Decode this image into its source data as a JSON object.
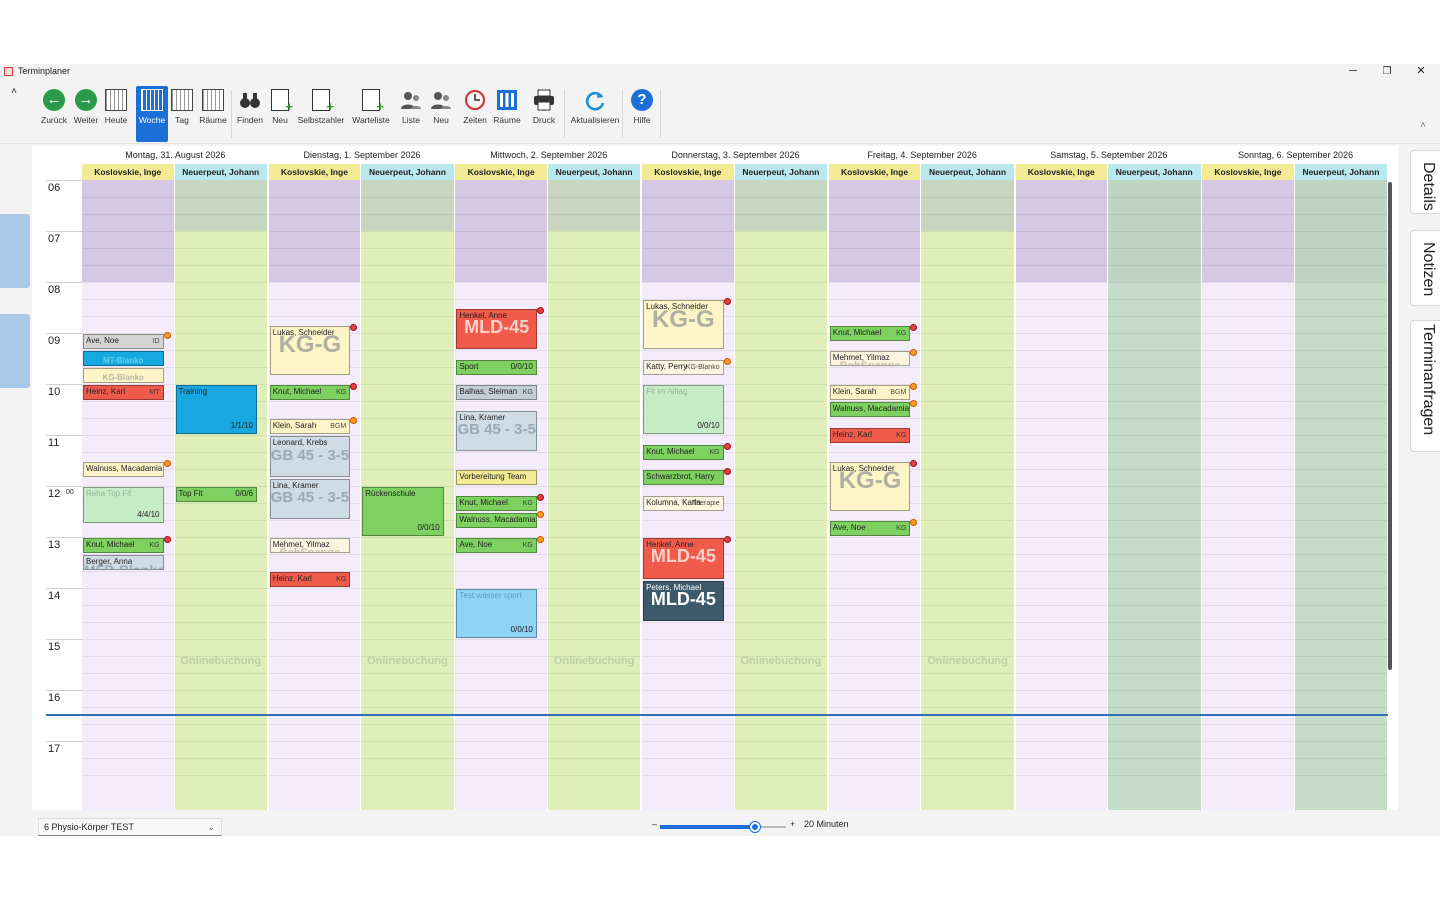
{
  "window": {
    "title": "Terminplaner",
    "minimize": "─",
    "maximize": "❐",
    "close": "✕"
  },
  "ribbon": {
    "collapse_icon": "˄",
    "expand_icon": "˄",
    "buttons": [
      {
        "id": "back",
        "label": "Zurück",
        "icon": "arrow-left-icon",
        "color": "#2a9a4a",
        "glyph": "←"
      },
      {
        "id": "forward",
        "label": "Weiter",
        "icon": "arrow-right-icon",
        "color": "#2a9a4a",
        "glyph": "→"
      },
      {
        "id": "today",
        "label": "Heute",
        "icon": "calendar-today-icon"
      },
      {
        "id": "week",
        "label": "Woche",
        "icon": "calendar-week-icon",
        "selected": true
      },
      {
        "id": "day",
        "label": "Tag",
        "icon": "calendar-day-icon"
      },
      {
        "id": "rooms1",
        "label": "Räume",
        "icon": "calendar-rooms-icon"
      },
      {
        "id": "find",
        "label": "Finden",
        "icon": "binoculars-icon"
      },
      {
        "id": "new1",
        "label": "Neu",
        "icon": "new-document-icon"
      },
      {
        "id": "selfpay",
        "label": "Selbstzahler",
        "icon": "selfpay-document-icon"
      },
      {
        "id": "waitlist",
        "label": "Warteliste",
        "icon": "edit-list-icon"
      },
      {
        "id": "list",
        "label": "Liste",
        "icon": "people-list-icon"
      },
      {
        "id": "new2",
        "label": "Neu",
        "icon": "people-add-icon"
      },
      {
        "id": "times",
        "label": "Zeiten",
        "icon": "clock-icon"
      },
      {
        "id": "rooms2",
        "label": "Räume",
        "icon": "columns-icon"
      },
      {
        "id": "print",
        "label": "Druck",
        "icon": "printer-icon"
      },
      {
        "id": "refresh",
        "label": "Aktualisieren",
        "icon": "refresh-icon"
      },
      {
        "id": "help",
        "label": "Hilfe",
        "icon": "help-icon",
        "color": "#1c6fd6",
        "glyph": "?"
      }
    ]
  },
  "right_tabs": [
    "Details",
    "Notizen",
    "Terminanfragen"
  ],
  "hours": [
    "06",
    "07",
    "08",
    "09",
    "10",
    "11",
    "12",
    "13",
    "14",
    "15",
    "16",
    "17"
  ],
  "hour_suffix": {
    "index": 6,
    "text": "00"
  },
  "days": [
    "Montag, 31. August 2026",
    "Dienstag, 1. September 2026",
    "Mittwoch, 2. September 2026",
    "Donnerstag, 3. September 2026",
    "Freitag, 4. September 2026",
    "Samstag, 5. September 2026",
    "Sonntag, 6. September 2026"
  ],
  "therapists": [
    {
      "name": "Koslovskie, Inge",
      "header_color": "#f2ea94"
    },
    {
      "name": "Neuerpeut, Johann",
      "header_color": "#b9e8ee"
    }
  ],
  "colors": {
    "inge_bg": "#f4ecfa",
    "johann_bg": "#e0efb9",
    "closed": "#d6c8e4",
    "weekend_johann": "#c5dcc8",
    "weekend_inge": "#f4ecfa",
    "now_line": "#2f6fb6",
    "accent": "#1c6fd6"
  },
  "online_label": "Onlinebuchung",
  "appointments": {
    "d0_inge": [
      {
        "start": "9:00",
        "end": "9:20",
        "name": "Ave, Noe",
        "tag": "ID",
        "bg": "#d4d4d4",
        "mark": "o"
      },
      {
        "start": "9:20",
        "end": "9:40",
        "name": "",
        "big": "MT-Blanko",
        "bigsize": 8,
        "bg": "#18a8e0",
        "fg": "#5fd0f4"
      },
      {
        "start": "9:40",
        "end": "10:00",
        "name": "",
        "big": "KG-Blanko",
        "bigsize": 8,
        "bg": "#fdf5c8",
        "fg": "#b8b8a0"
      },
      {
        "start": "10:00",
        "end": "10:20",
        "name": "Heinz, Karl",
        "tag": "MT",
        "bg": "#f05a4a"
      },
      {
        "start": "11:30",
        "end": "11:50",
        "name": "Walnuss, Macadamia",
        "bg": "#fdf5c8",
        "mark": "o"
      },
      {
        "start": "12:00",
        "end": "12:45",
        "name": "Reha Top Fit",
        "bg": "#c6ecc6",
        "fg": "#9ab49a",
        "count": "4/4/10"
      },
      {
        "start": "13:00",
        "end": "13:20",
        "name": "Knut, Michael",
        "tag": "KG",
        "bg": "#7ed060",
        "mark": "s"
      },
      {
        "start": "13:20",
        "end": "13:40",
        "name": "Berger, Anna",
        "big": "MFB-Blanko",
        "bigsize": 14,
        "bg": "#cfdce6",
        "fg": "#9aaab4"
      }
    ],
    "d0_johann": [
      {
        "start": "10:00",
        "end": "11:00",
        "name": "Training",
        "bg": "#18a8e0",
        "count": "1/1/10"
      },
      {
        "start": "12:00",
        "end": "12:20",
        "name": "Top Fit",
        "bg": "#7ed060",
        "count": "0/0/6"
      }
    ],
    "d1_inge": [
      {
        "start": "8:50",
        "end": "9:50",
        "name": "Lukas, Schneider",
        "big": "KG-G",
        "bigsize": 24,
        "bg": "#fdf5c8",
        "fg": "#b0b0a0",
        "mark": "s"
      },
      {
        "start": "10:00",
        "end": "10:20",
        "name": "Knut, Michael",
        "tag": "KG",
        "bg": "#7ed060",
        "mark": "s"
      },
      {
        "start": "10:40",
        "end": "11:00",
        "name": "Klein, Sarah",
        "tag": "BGM",
        "bg": "#fdf5c8",
        "mark": "o"
      },
      {
        "start": "11:00",
        "end": "11:50",
        "name": "Leonard, Krebs",
        "big": "GB 45 - 3-5",
        "bigsize": 15,
        "bg": "#cfdce6",
        "fg": "#9aaab4"
      },
      {
        "start": "11:50",
        "end": "12:40",
        "name": "Lina, Kramer",
        "big": "GB 45 - 3-5",
        "bigsize": 15,
        "bg": "#cfdce6",
        "fg": "#9aaab4"
      },
      {
        "start": "13:00",
        "end": "13:20",
        "name": "Mehmet, Yilmaz",
        "big": "BehSpange",
        "bigsize": 11,
        "bg": "#fdf5e0",
        "fg": "#c8c0b0"
      },
      {
        "start": "13:40",
        "end": "14:00",
        "name": "Heinz, Karl",
        "tag": "KG",
        "bg": "#f05a4a"
      }
    ],
    "d1_johann": [
      {
        "start": "12:00",
        "end": "13:00",
        "name": "Rückenschule",
        "bg": "#7ed060",
        "count": "0/0/10"
      }
    ],
    "d2_inge": [
      {
        "start": "8:30",
        "end": "9:20",
        "name": "Henkel, Anne",
        "big": "MLD-45",
        "bigsize": 18,
        "bg": "#f05a4a",
        "fg": "#ffd0c8",
        "mark": "s"
      },
      {
        "start": "9:30",
        "end": "9:50",
        "name": "Sport",
        "bg": "#7ed060",
        "count": "0/0/10"
      },
      {
        "start": "10:00",
        "end": "10:20",
        "name": "Balhas, Sleiman",
        "tag": "KG",
        "bg": "#c2cdd6"
      },
      {
        "start": "10:30",
        "end": "11:20",
        "name": "Lina, Kramer",
        "big": "GB 45 - 3-5",
        "bigsize": 15,
        "bg": "#cfdce6",
        "fg": "#9aaab4"
      },
      {
        "start": "11:40",
        "end": "12:00",
        "name": "Vorbereitung Team",
        "bg": "#f2ea94"
      },
      {
        "start": "12:10",
        "end": "12:30",
        "name": "Knut, Michael",
        "tag": "KG",
        "bg": "#7ed060",
        "mark": "s"
      },
      {
        "start": "12:30",
        "end": "12:50",
        "name": "Walnuss, Macadamia",
        "bg": "#7ed060",
        "mark": "o"
      },
      {
        "start": "13:00",
        "end": "13:20",
        "name": "Ave, Noe",
        "tag": "KG",
        "bg": "#7ed060",
        "mark": "o"
      },
      {
        "start": "14:00",
        "end": "15:00",
        "name": "Test wasser sport",
        "bg": "#8fd4f4",
        "fg": "#5aa0c8",
        "count": "0/0/10"
      }
    ],
    "d3_inge": [
      {
        "start": "8:20",
        "end": "9:20",
        "name": "Lukas, Schneider",
        "big": "KG-G",
        "bigsize": 24,
        "bg": "#fdf5c8",
        "fg": "#b0b0a0",
        "mark": "s"
      },
      {
        "start": "9:30",
        "end": "9:50",
        "name": "Katty, Perry",
        "tag": "KG-Blanko",
        "bg": "#fdf5e0",
        "mark": "o"
      },
      {
        "start": "10:00",
        "end": "11:00",
        "name": "Fit im Alltag",
        "bg": "#c6ecc6",
        "fg": "#9ab49a",
        "count": "0/0/10"
      },
      {
        "start": "11:10",
        "end": "11:30",
        "name": "Knut, Michael",
        "tag": "KG",
        "bg": "#7ed060",
        "mark": "s"
      },
      {
        "start": "11:40",
        "end": "12:00",
        "name": "Schwarzbrot, Harry",
        "bg": "#7ed060",
        "mark": "s"
      },
      {
        "start": "12:10",
        "end": "12:30",
        "name": "Kolumna, Karla",
        "tag": "Therapie",
        "bg": "#fdf5e0"
      },
      {
        "start": "13:00",
        "end": "13:50",
        "name": "Henkel, Anne",
        "big": "MLD-45",
        "bigsize": 18,
        "bg": "#f05a4a",
        "fg": "#ffd0c8",
        "mark": "s"
      },
      {
        "start": "13:50",
        "end": "14:40",
        "name": "Peters, Michael",
        "big": "MLD-45",
        "bigsize": 18,
        "bg": "#3c5a6c",
        "fg": "#ffffff",
        "namecolor": "#fff"
      }
    ],
    "d4_inge": [
      {
        "start": "8:50",
        "end": "9:10",
        "name": "Knut, Michael",
        "tag": "KG",
        "bg": "#7ed060",
        "mark": "s"
      },
      {
        "start": "9:20",
        "end": "9:40",
        "name": "Mehmet, Yilmaz",
        "big": "BehSpange",
        "bigsize": 11,
        "bg": "#fdf5e0",
        "fg": "#c8c0b0",
        "mark": "o"
      },
      {
        "start": "10:00",
        "end": "10:20",
        "name": "Klein, Sarah",
        "tag": "BGM",
        "bg": "#fdf5c8",
        "mark": "o"
      },
      {
        "start": "10:20",
        "end": "10:40",
        "name": "Walnuss, Macadamia",
        "bg": "#7ed060",
        "mark": "o"
      },
      {
        "start": "10:50",
        "end": "11:10",
        "name": "Heinz, Karl",
        "tag": "KG",
        "bg": "#f05a4a"
      },
      {
        "start": "11:30",
        "end": "12:30",
        "name": "Lukas, Schneider",
        "big": "KG-G",
        "bigsize": 24,
        "bg": "#fdf5c8",
        "fg": "#b0b0a0",
        "mark": "s"
      },
      {
        "start": "12:40",
        "end": "13:00",
        "name": "Ave, Noe",
        "tag": "KG",
        "bg": "#7ed060",
        "mark": "o"
      }
    ]
  },
  "status": {
    "scope": "6 Physio-Körper TEST",
    "scope_chevron": "⌄",
    "zoom_minus": "–",
    "zoom_plus": "+",
    "zoom_fraction": 0.75,
    "zoom_label": "20 Minuten"
  }
}
